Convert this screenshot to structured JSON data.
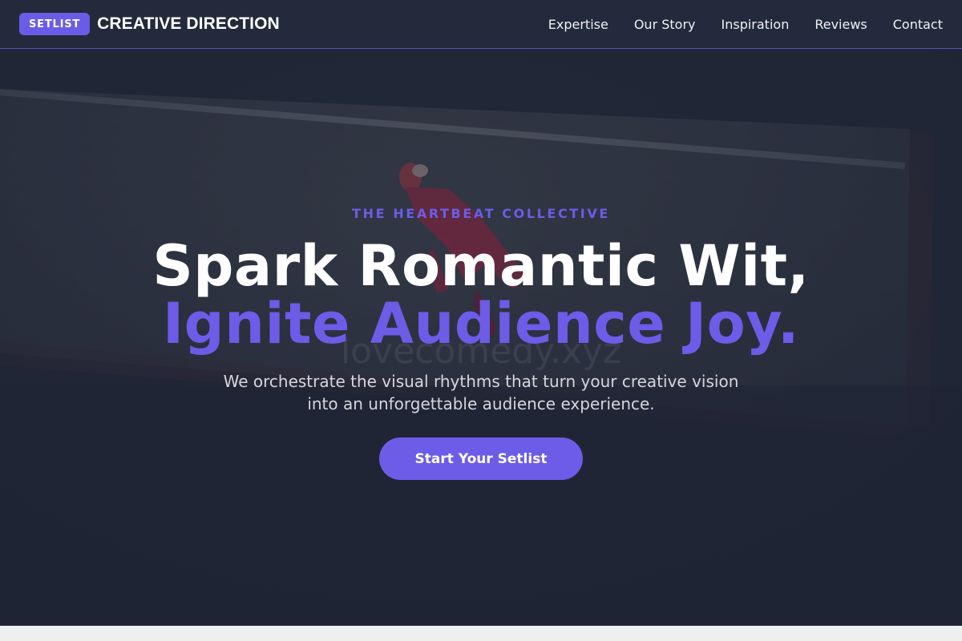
{
  "nav": {
    "badge": "SETLIST",
    "brand": "CREATIVE DIRECTION",
    "links": [
      "Expertise",
      "Our Story",
      "Inspiration",
      "Reviews",
      "Contact"
    ]
  },
  "hero": {
    "eyebrow": "THE HEARTBEAT COLLECTIVE",
    "headline_line1": "Spark Romantic Wit,",
    "headline_line2": "Ignite Audience Joy.",
    "subtext_line1": "We orchestrate the visual rhythms that turn your creative vision",
    "subtext_line2": "into an unforgettable audience experience.",
    "cta": "Start Your Setlist",
    "watermark": "lovecomedy.xyz"
  },
  "colors": {
    "accent": "#6c5ce7",
    "nav_bg": "#222a3b",
    "hero_overlay": "#1f2535"
  }
}
